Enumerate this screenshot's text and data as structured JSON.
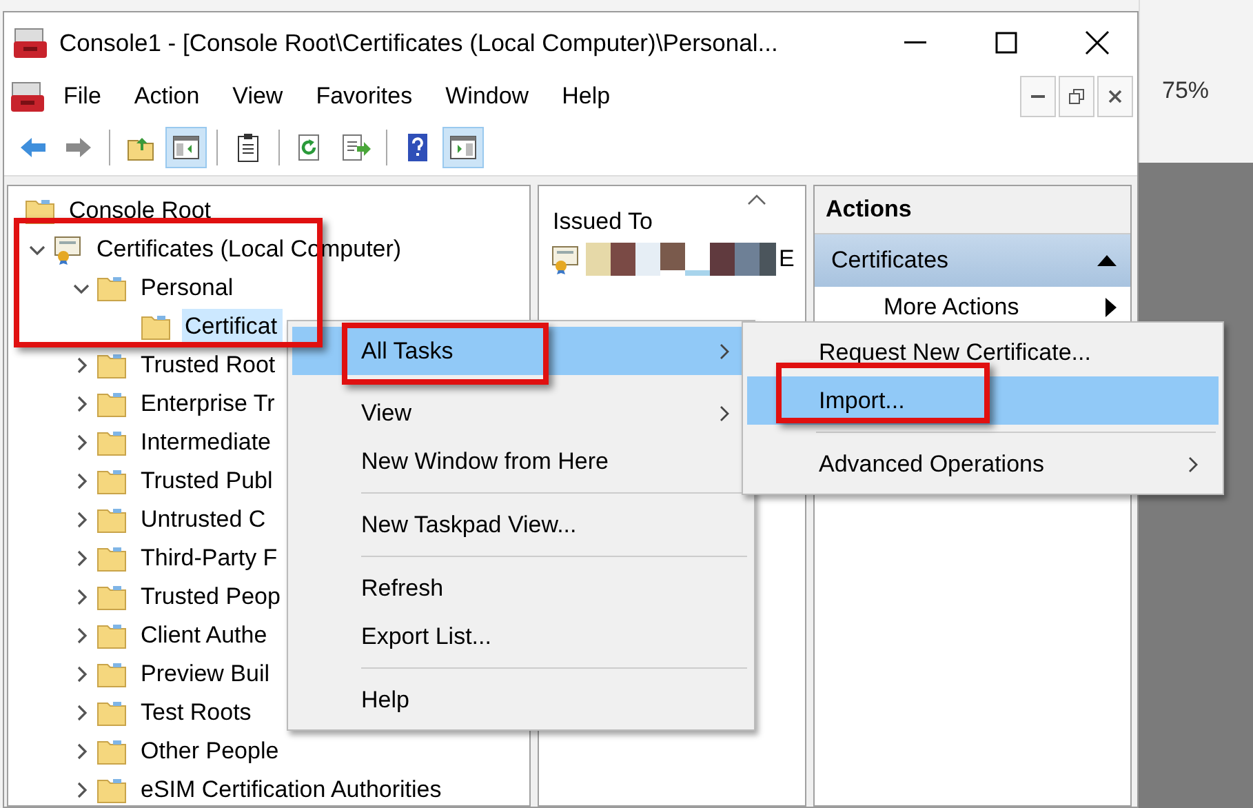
{
  "window": {
    "title": "Console1 - [Console Root\\Certificates (Local Computer)\\Personal..."
  },
  "menu_bar": [
    "File",
    "Action",
    "View",
    "Favorites",
    "Window",
    "Help"
  ],
  "toolbar": [
    {
      "kind": "back",
      "pressed": false
    },
    {
      "kind": "forward",
      "pressed": false
    },
    {
      "kind": "separator"
    },
    {
      "kind": "up",
      "pressed": false
    },
    {
      "kind": "tree",
      "pressed": true
    },
    {
      "kind": "separator"
    },
    {
      "kind": "properties",
      "pressed": false
    },
    {
      "kind": "separator"
    },
    {
      "kind": "refresh",
      "pressed": false
    },
    {
      "kind": "export",
      "pressed": false
    },
    {
      "kind": "separator"
    },
    {
      "kind": "help",
      "pressed": false
    },
    {
      "kind": "actionpane",
      "pressed": true
    }
  ],
  "zoom_label": "75%",
  "tree": [
    {
      "label": "Console Root",
      "kind": "folder",
      "selected": false,
      "children": [
        {
          "label": "Certificates (Local Computer)",
          "kind": "store",
          "expanded": true,
          "selected": false,
          "children": [
            {
              "label": "Personal",
              "kind": "folder",
              "expanded": true,
              "selected": false,
              "children": [
                {
                  "label": "Certificat",
                  "kind": "folder",
                  "selected": true
                }
              ]
            },
            {
              "label": "Trusted Root",
              "kind": "folder",
              "expanded": false,
              "selected": false
            },
            {
              "label": "Enterprise Tr",
              "kind": "folder",
              "expanded": false,
              "selected": false
            },
            {
              "label": "Intermediate",
              "kind": "folder",
              "expanded": false,
              "selected": false
            },
            {
              "label": "Trusted Publ",
              "kind": "folder",
              "expanded": false,
              "selected": false
            },
            {
              "label": "Untrusted C",
              "kind": "folder",
              "expanded": false,
              "selected": false
            },
            {
              "label": "Third-Party F",
              "kind": "folder",
              "expanded": false,
              "selected": false
            },
            {
              "label": "Trusted Peop",
              "kind": "folder",
              "expanded": false,
              "selected": false
            },
            {
              "label": "Client Authe",
              "kind": "folder",
              "expanded": false,
              "selected": false
            },
            {
              "label": "Preview Buil",
              "kind": "folder",
              "expanded": false,
              "selected": false
            },
            {
              "label": "Test Roots",
              "kind": "folder",
              "expanded": false,
              "selected": false
            },
            {
              "label": "Other People",
              "kind": "folder",
              "expanded": false,
              "selected": false
            },
            {
              "label": "eSIM Certification Authorities",
              "kind": "folder",
              "expanded": false,
              "selected": false
            }
          ]
        }
      ]
    }
  ],
  "list": {
    "columns": [
      "Issued To"
    ],
    "rows": [
      {
        "issued_to": "E"
      }
    ]
  },
  "actions": {
    "title": "Actions",
    "items": [
      {
        "kind": "group",
        "label": "Certificates",
        "expanded": true
      },
      {
        "kind": "action",
        "label": "More Actions"
      }
    ]
  },
  "context_menu": [
    {
      "kind": "item",
      "label": "All Tasks",
      "selected": true,
      "submenu": true
    },
    {
      "kind": "item",
      "label": "View",
      "selected": false,
      "submenu": true
    },
    {
      "kind": "item",
      "label": "New Window from Here",
      "selected": false,
      "submenu": false
    },
    {
      "kind": "separator"
    },
    {
      "kind": "item",
      "label": "New Taskpad View...",
      "selected": false,
      "submenu": false
    },
    {
      "kind": "separator"
    },
    {
      "kind": "item",
      "label": "Refresh",
      "selected": false,
      "submenu": false
    },
    {
      "kind": "item",
      "label": "Export List...",
      "selected": false,
      "submenu": false
    },
    {
      "kind": "separator"
    },
    {
      "kind": "item",
      "label": "Help",
      "selected": false,
      "submenu": false
    }
  ],
  "submenu": [
    {
      "kind": "item",
      "label": "Request New Certificate...",
      "selected": false,
      "submenu": false
    },
    {
      "kind": "item",
      "label": "Import...",
      "selected": true,
      "submenu": false
    },
    {
      "kind": "separator"
    },
    {
      "kind": "item",
      "label": "Advanced Operations",
      "selected": false,
      "submenu": true
    }
  ]
}
